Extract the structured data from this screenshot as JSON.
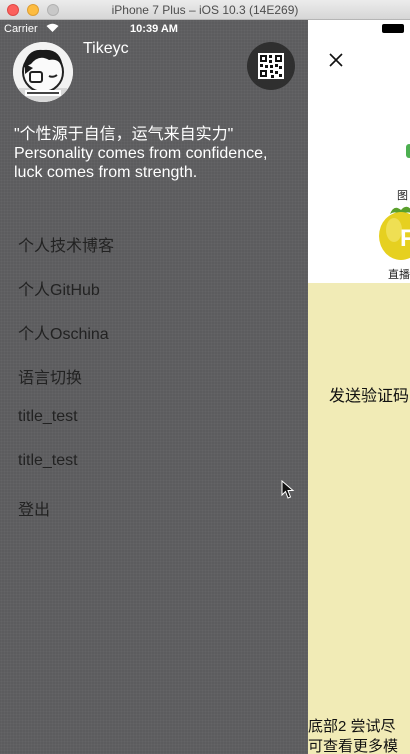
{
  "simulator": {
    "window_title": "iPhone 7 Plus – iOS 10.3 (14E269)"
  },
  "status_bar": {
    "carrier": "Carrier",
    "time": "10:39 AM"
  },
  "drawer": {
    "username": "Tikeyc",
    "quote": "\"个性源于自信，运气来自实力\" Personality comes from confidence, luck comes from strength.",
    "menu": [
      {
        "label": "个人技术博客"
      },
      {
        "label": "个人GitHub"
      },
      {
        "label": "个人Oschina"
      },
      {
        "label": "语言切换"
      },
      {
        "label": "title_test"
      },
      {
        "label": "title_test"
      },
      {
        "label": "登出"
      }
    ]
  },
  "panel": {
    "label_tu": "图",
    "label_zhibo": "直播",
    "send_code": "发送验证码",
    "bottom_line1": "底部2 尝试尽",
    "bottom_line2": "可查看更多模"
  },
  "icons": {
    "avatar": "avatar-image",
    "qr": "qr-code-icon",
    "close": "close-icon",
    "wifi": "wifi-icon",
    "battery": "battery-icon",
    "cursor": "mouse-cursor",
    "strawberry": "strawberry-icon"
  },
  "colors": {
    "drawer_bg": "#5c5c5e",
    "panel_bg": "#ffffff",
    "panel_yellow": "#f1ebb6",
    "menu_text": "#222222",
    "header_text": "#ffffff"
  }
}
